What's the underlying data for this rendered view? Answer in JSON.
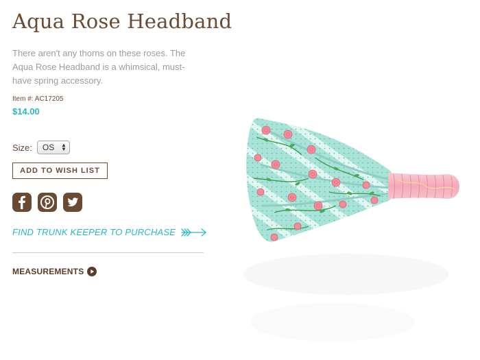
{
  "product": {
    "title": "Aqua Rose Headband",
    "description": "There aren't any thorns on these roses. The Aqua Rose Headband is a whimsical, must-have spring accessory.",
    "item_number": "Item #: AC17205",
    "price": "$14.00",
    "size_label": "Size:",
    "size_value": "OS"
  },
  "actions": {
    "wish_list": "ADD TO WISH LIST",
    "find_trunk_keeper": "FIND TRUNK KEEPER TO PURCHASE",
    "measurements": "MEASUREMENTS"
  },
  "social": [
    "facebook-icon",
    "pinterest-icon",
    "twitter-icon"
  ],
  "colors": {
    "brown": "#6b4a33",
    "teal": "#27b7c9",
    "gray_text": "#9b9b9b",
    "fabric_aqua": "#a9e2d7",
    "band_pink": "#f6b7c3"
  }
}
